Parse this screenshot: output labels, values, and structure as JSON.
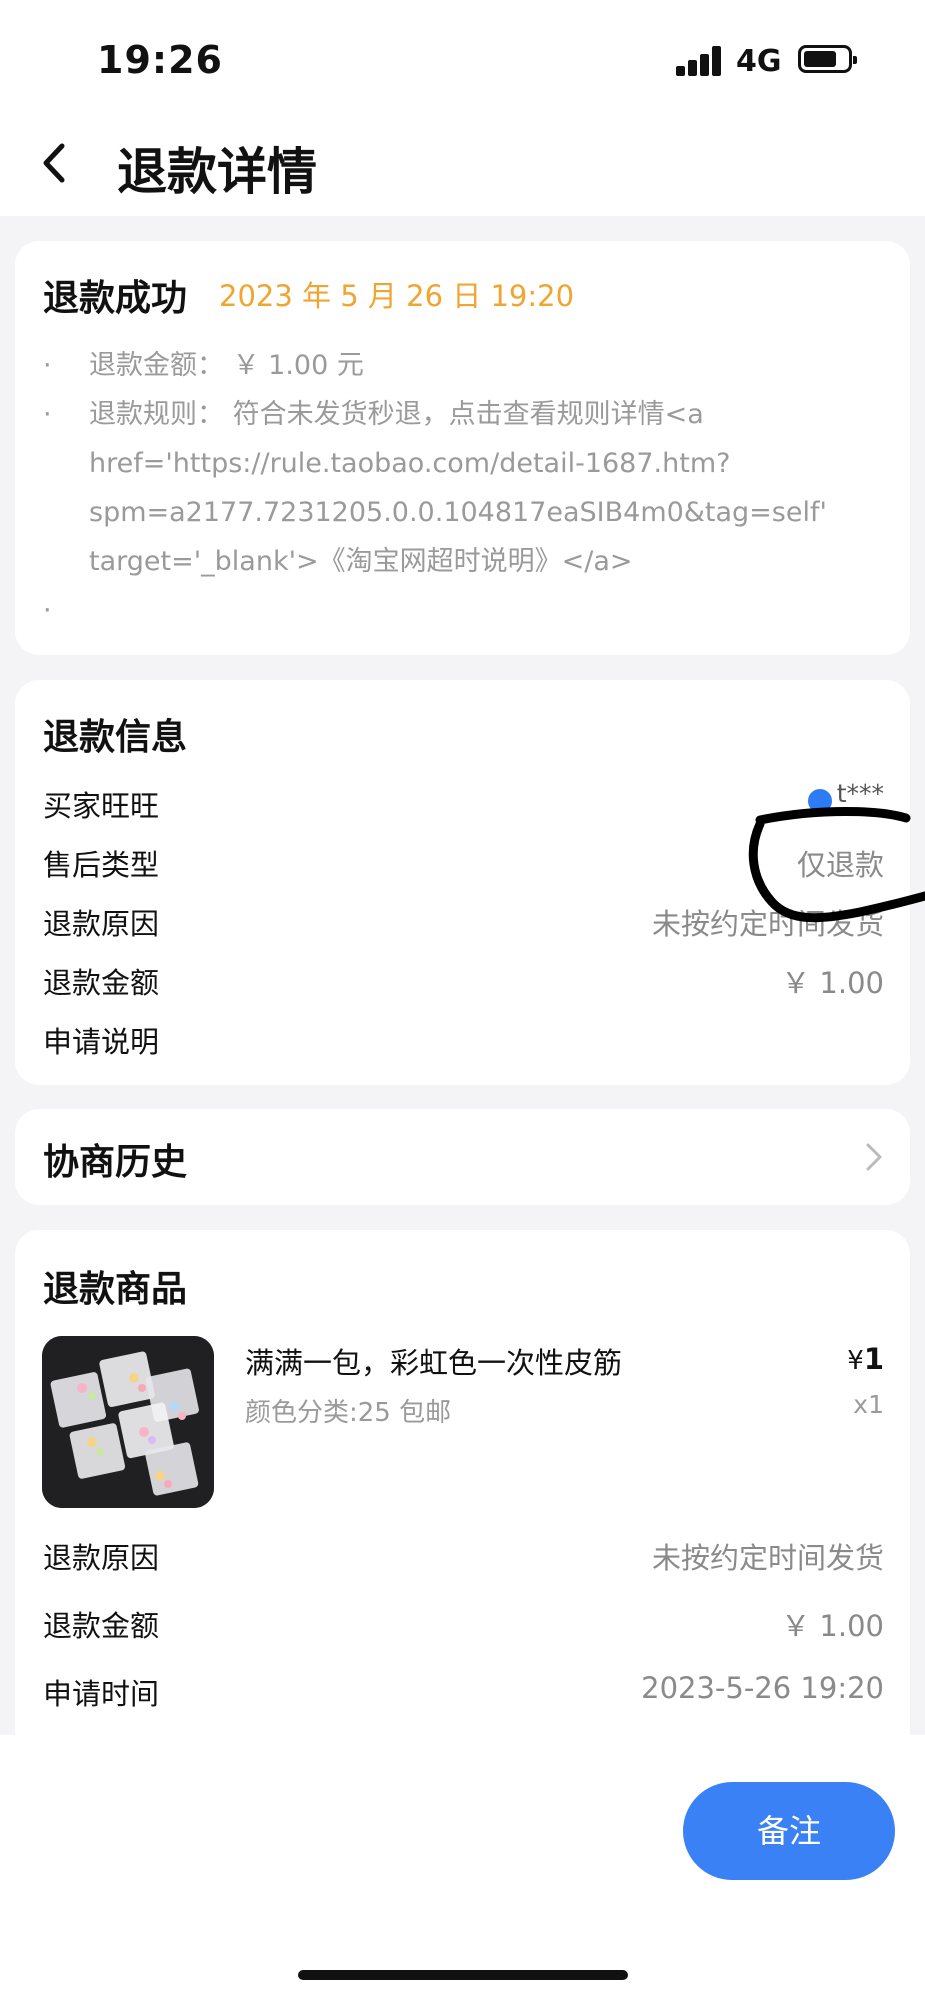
{
  "status_bar": {
    "time": "19:26",
    "network": "4G"
  },
  "nav": {
    "title": "退款详情"
  },
  "refund_status": {
    "title": "退款成功",
    "time": "2023 年 5 月 26 日 19:20",
    "bullet": "·",
    "lines": [
      "退款金额： ￥ 1.00 元",
      "退款规则： 符合未发货秒退，点击查看规则详情<a",
      "href='https://rule.taobao.com/detail-1687.htm?",
      "spm=a2177.7231205.0.0.104817eaSIB4m0&tag=self'",
      "target='_blank'>《淘宝网超时说明》</a>"
    ]
  },
  "refund_info": {
    "title": "退款信息",
    "rows": [
      {
        "key": "买家旺旺",
        "value": "t***"
      },
      {
        "key": "售后类型",
        "value": "仅退款"
      },
      {
        "key": "退款原因",
        "value": "未按约定时间发货"
      },
      {
        "key": "退款金额",
        "value": "￥ 1.00"
      },
      {
        "key": "申请说明",
        "value": ""
      }
    ]
  },
  "history": {
    "title": "协商历史"
  },
  "refund_goods": {
    "title": "退款商品",
    "product": {
      "name": "满满一包，彩虹色一次性皮筋",
      "spec": "颜色分类:25 包邮",
      "price_symbol": "¥",
      "price": "1",
      "qty": "x1"
    },
    "rows": [
      {
        "key": "退款原因",
        "value": "未按约定时间发货"
      },
      {
        "key": "退款金额",
        "value": "￥ 1.00"
      },
      {
        "key": "申请时间",
        "value": "2023-5-26 19:20"
      }
    ]
  },
  "actions": {
    "note_label": "备注"
  },
  "colors": {
    "accent_blue": "#3a81f6",
    "status_orange": "#f0a531",
    "annotation_ink": "#000000"
  },
  "icons": [
    "back-chevron-icon",
    "chevron-right-icon",
    "wangwang-icon",
    "signal-icon",
    "battery-icon"
  ]
}
